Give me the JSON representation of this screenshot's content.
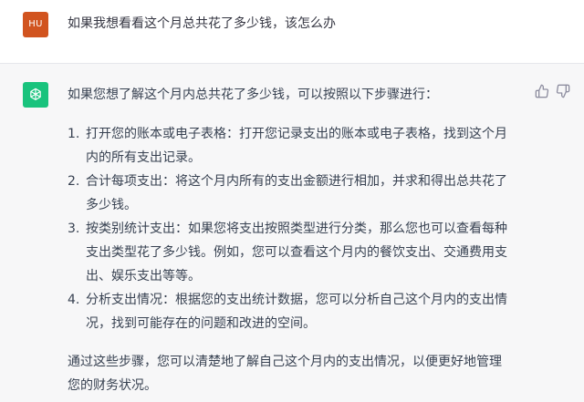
{
  "user_message": {
    "avatar_initials": "HU",
    "text": "如果我想看看这个月总共花了多少钱，该怎么办"
  },
  "assistant_message": {
    "avatar_icon": "openai-logo-icon",
    "intro": "如果您想了解这个月内总共花了多少钱，可以按照以下步骤进行：",
    "steps": [
      {
        "number": "1.",
        "lines": [
          "打开您的账本或电子表格：打开您记录支出的账本或电子表格，找到这个月",
          "内的所有支出记录。"
        ]
      },
      {
        "number": "2.",
        "lines": [
          "合计每项支出：将这个月内所有的支出金额进行相加，并求和得出总共花了",
          "多少钱。"
        ]
      },
      {
        "number": "3.",
        "lines": [
          "按类别统计支出：如果您将支出按照类型进行分类，那么您也可以查看每种",
          "支出类型花了多少钱。例如，您可以查看这个月内的餐饮支出、交通费用支",
          "出、娱乐支出等等。"
        ]
      },
      {
        "number": "4.",
        "lines": [
          "分析支出情况：根据您的支出统计数据，您可以分析自己这个月内的支出情",
          "况，找到可能存在的问题和改进的空间。"
        ]
      }
    ],
    "outro_lines": [
      "通过这些步骤，您可以清楚地了解自己这个月内的支出情况，以便更好地管理",
      "您的财务状况。"
    ]
  },
  "colors": {
    "user_avatar": "#d1541f",
    "assistant_avatar": "#19c37d",
    "assistant_background": "#f7f7f8"
  },
  "icons": {
    "thumbs_up": "thumbs-up-icon",
    "thumbs_down": "thumbs-down-icon"
  }
}
